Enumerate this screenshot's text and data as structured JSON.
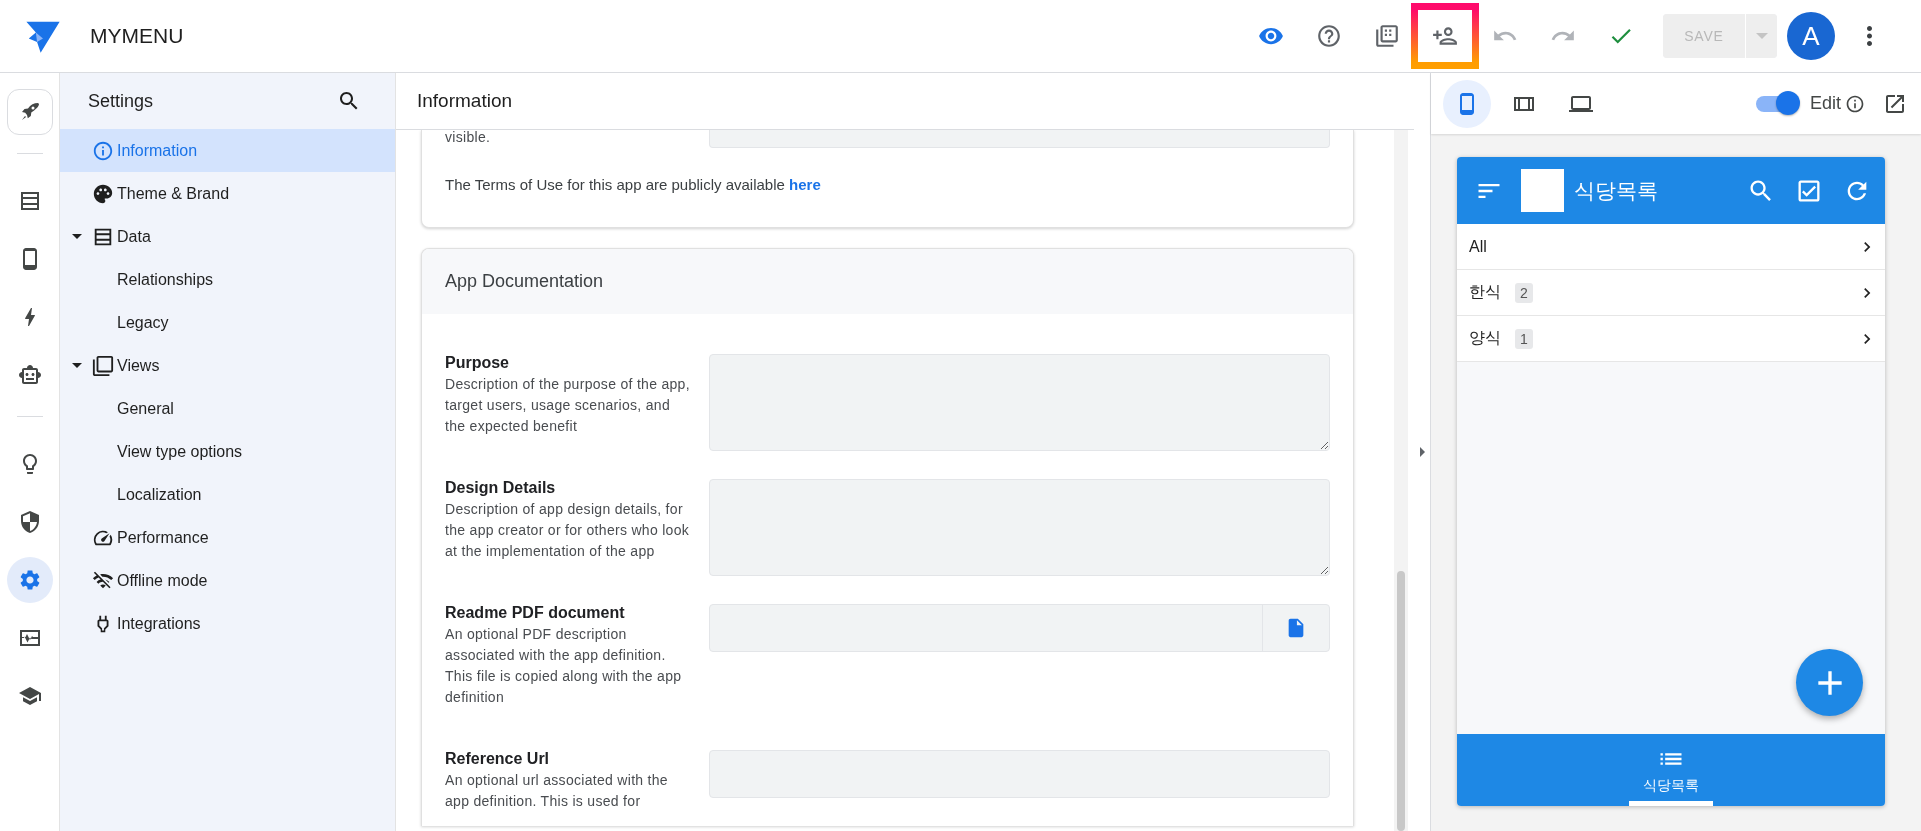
{
  "app_bar": {
    "title": "MYMENU",
    "tools": [
      {
        "kind": "preview",
        "disabled": false,
        "highlighted": false
      },
      {
        "kind": "help",
        "disabled": false,
        "highlighted": false
      },
      {
        "kind": "gallery",
        "disabled": false,
        "highlighted": false
      },
      {
        "kind": "add-person",
        "disabled": false,
        "highlighted": true
      },
      {
        "kind": "undo",
        "disabled": true,
        "highlighted": false
      },
      {
        "kind": "redo",
        "disabled": true,
        "highlighted": false
      },
      {
        "kind": "check",
        "disabled": false,
        "highlighted": false
      }
    ],
    "save": {
      "label": "SAVE",
      "disabled": true
    },
    "avatar": {
      "letter": "A"
    }
  },
  "rail": {
    "groups": [
      [
        {
          "kind": "rocket",
          "selected": false
        }
      ],
      [
        {
          "kind": "data",
          "selected": false
        },
        {
          "kind": "phone",
          "selected": false
        },
        {
          "kind": "bolt",
          "selected": false
        },
        {
          "kind": "bot",
          "selected": false
        }
      ],
      [
        {
          "kind": "bulb",
          "selected": false
        },
        {
          "kind": "shield",
          "selected": false
        },
        {
          "kind": "settings",
          "selected": true
        },
        {
          "kind": "monitor",
          "selected": false
        },
        {
          "kind": "school",
          "selected": false
        }
      ]
    ]
  },
  "settings": {
    "title": "Settings",
    "items": [
      {
        "label": "Information",
        "kind": "info",
        "selected": true
      },
      {
        "label": "Theme & Brand",
        "kind": "theme",
        "selected": false
      },
      {
        "label": "Data",
        "kind": "data",
        "selected": false,
        "expanded": true,
        "children": [
          {
            "label": "Relationships",
            "selected": false
          },
          {
            "label": "Legacy",
            "selected": false
          }
        ]
      },
      {
        "label": "Views",
        "kind": "views",
        "selected": false,
        "expanded": true,
        "children": [
          {
            "label": "General",
            "selected": false
          },
          {
            "label": "View type options",
            "selected": false
          },
          {
            "label": "Localization",
            "selected": false
          }
        ]
      },
      {
        "label": "Performance",
        "kind": "performance",
        "selected": false
      },
      {
        "label": "Offline mode",
        "kind": "offline",
        "selected": false
      },
      {
        "label": "Integrations",
        "kind": "integrations",
        "selected": false
      }
    ]
  },
  "content": {
    "title": "Information",
    "cut_label": "visible.",
    "terms": {
      "text": "The Terms of Use for this app are publicly available",
      "link": "here"
    },
    "section": {
      "title": "App Documentation",
      "fields": [
        {
          "label": "Purpose",
          "description": "Description of the purpose of the app, target users, usage scenarios, and the expected benefit",
          "kind": "textarea"
        },
        {
          "label": "Design Details",
          "description": "Description of app design details, for the app creator or for others who look at the implementation of the app",
          "kind": "textarea"
        },
        {
          "label": "Readme PDF document",
          "description": "An optional PDF description associated with the app definition. This file is copied along with the app definition",
          "kind": "file"
        },
        {
          "label": "Reference Url",
          "description": "An optional url associated with the app definition. This is used for",
          "kind": "text"
        }
      ]
    }
  },
  "preview": {
    "devices": [
      {
        "kind": "phone",
        "selected": true
      },
      {
        "kind": "tablet",
        "selected": false
      },
      {
        "kind": "laptop",
        "selected": false
      }
    ],
    "edit": {
      "label": "Edit",
      "on": true
    },
    "app": {
      "title": "식당목록",
      "rows": [
        {
          "label": "All"
        },
        {
          "label": "한식",
          "count": "2"
        },
        {
          "label": "양식",
          "count": "1"
        }
      ],
      "nav": [
        {
          "label": "식당목록",
          "selected": true
        }
      ]
    }
  }
}
